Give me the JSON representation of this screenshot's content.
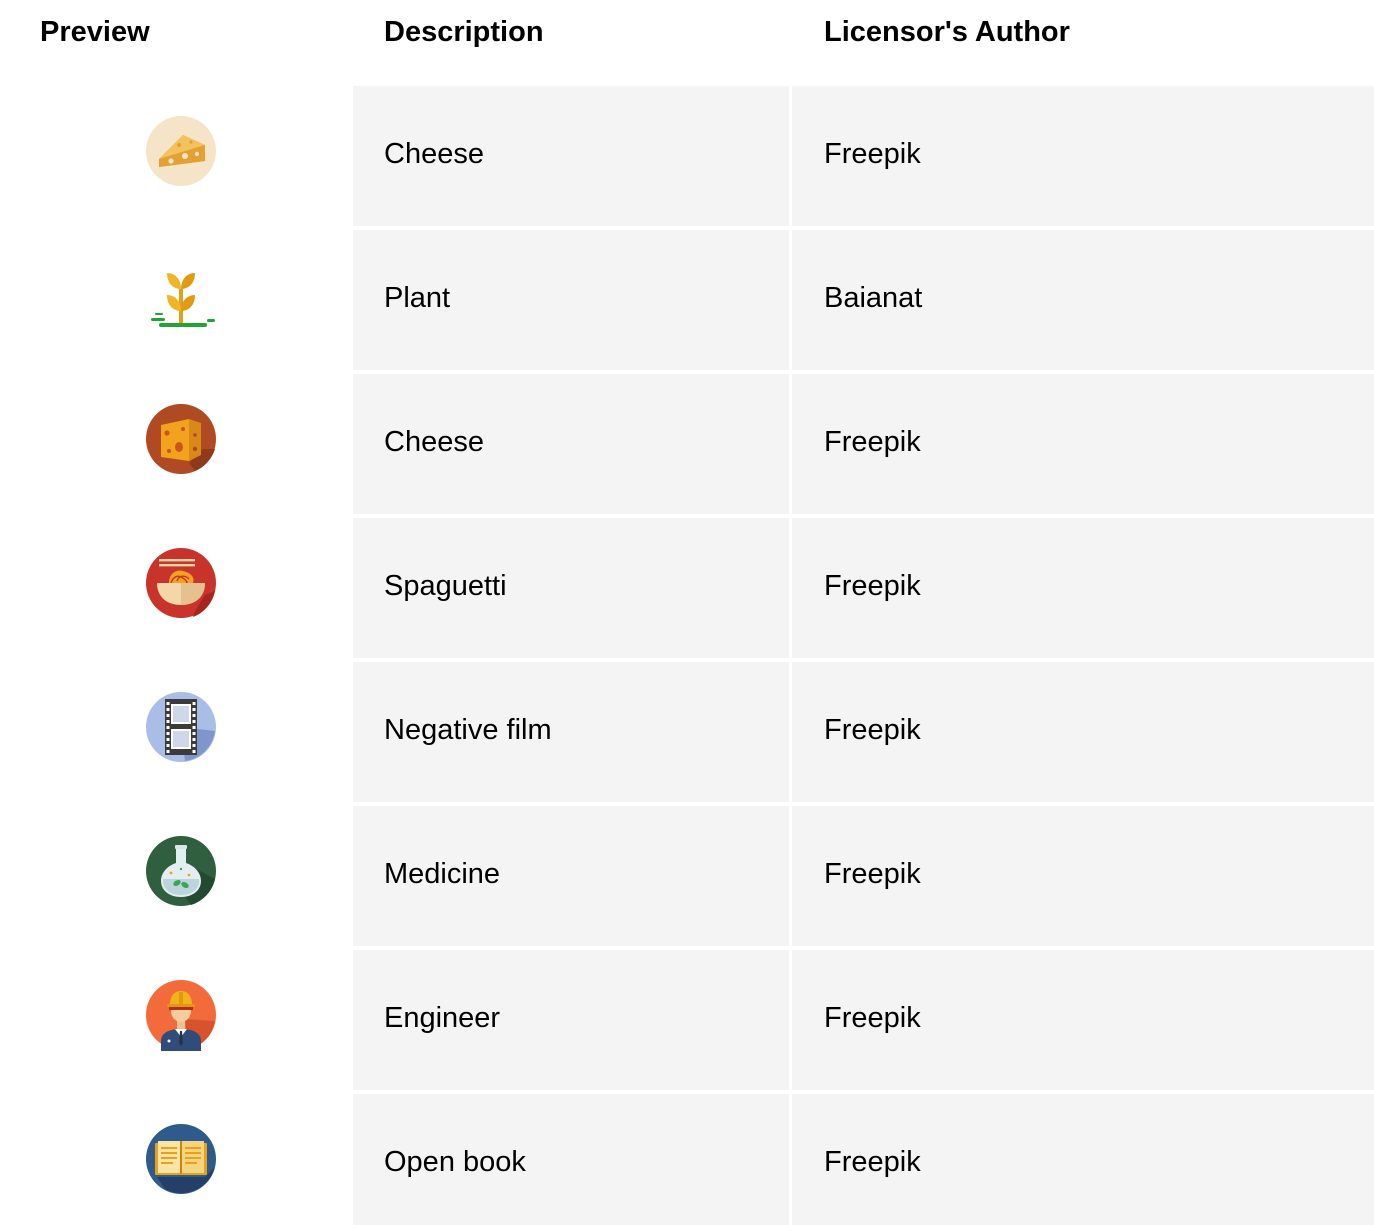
{
  "header": {
    "preview": "Preview",
    "description": "Description",
    "author": "Licensor's Author"
  },
  "rows": [
    {
      "icon": "cheese-wedge-icon",
      "description": "Cheese",
      "author": "Freepik"
    },
    {
      "icon": "plant-icon",
      "description": "Plant",
      "author": "Baianat"
    },
    {
      "icon": "cheese-block-icon",
      "description": "Cheese",
      "author": "Freepik"
    },
    {
      "icon": "spaghetti-bowl-icon",
      "description": "Spaguetti",
      "author": "Freepik"
    },
    {
      "icon": "film-strip-icon",
      "description": "Negative film",
      "author": "Freepik"
    },
    {
      "icon": "flask-icon",
      "description": "Medicine",
      "author": "Freepik"
    },
    {
      "icon": "engineer-icon",
      "description": "Engineer",
      "author": "Freepik"
    },
    {
      "icon": "open-book-icon",
      "description": "Open book",
      "author": "Freepik"
    }
  ],
  "colors": {
    "cell_background": "#f4f4f4",
    "page_background": "#ffffff"
  }
}
